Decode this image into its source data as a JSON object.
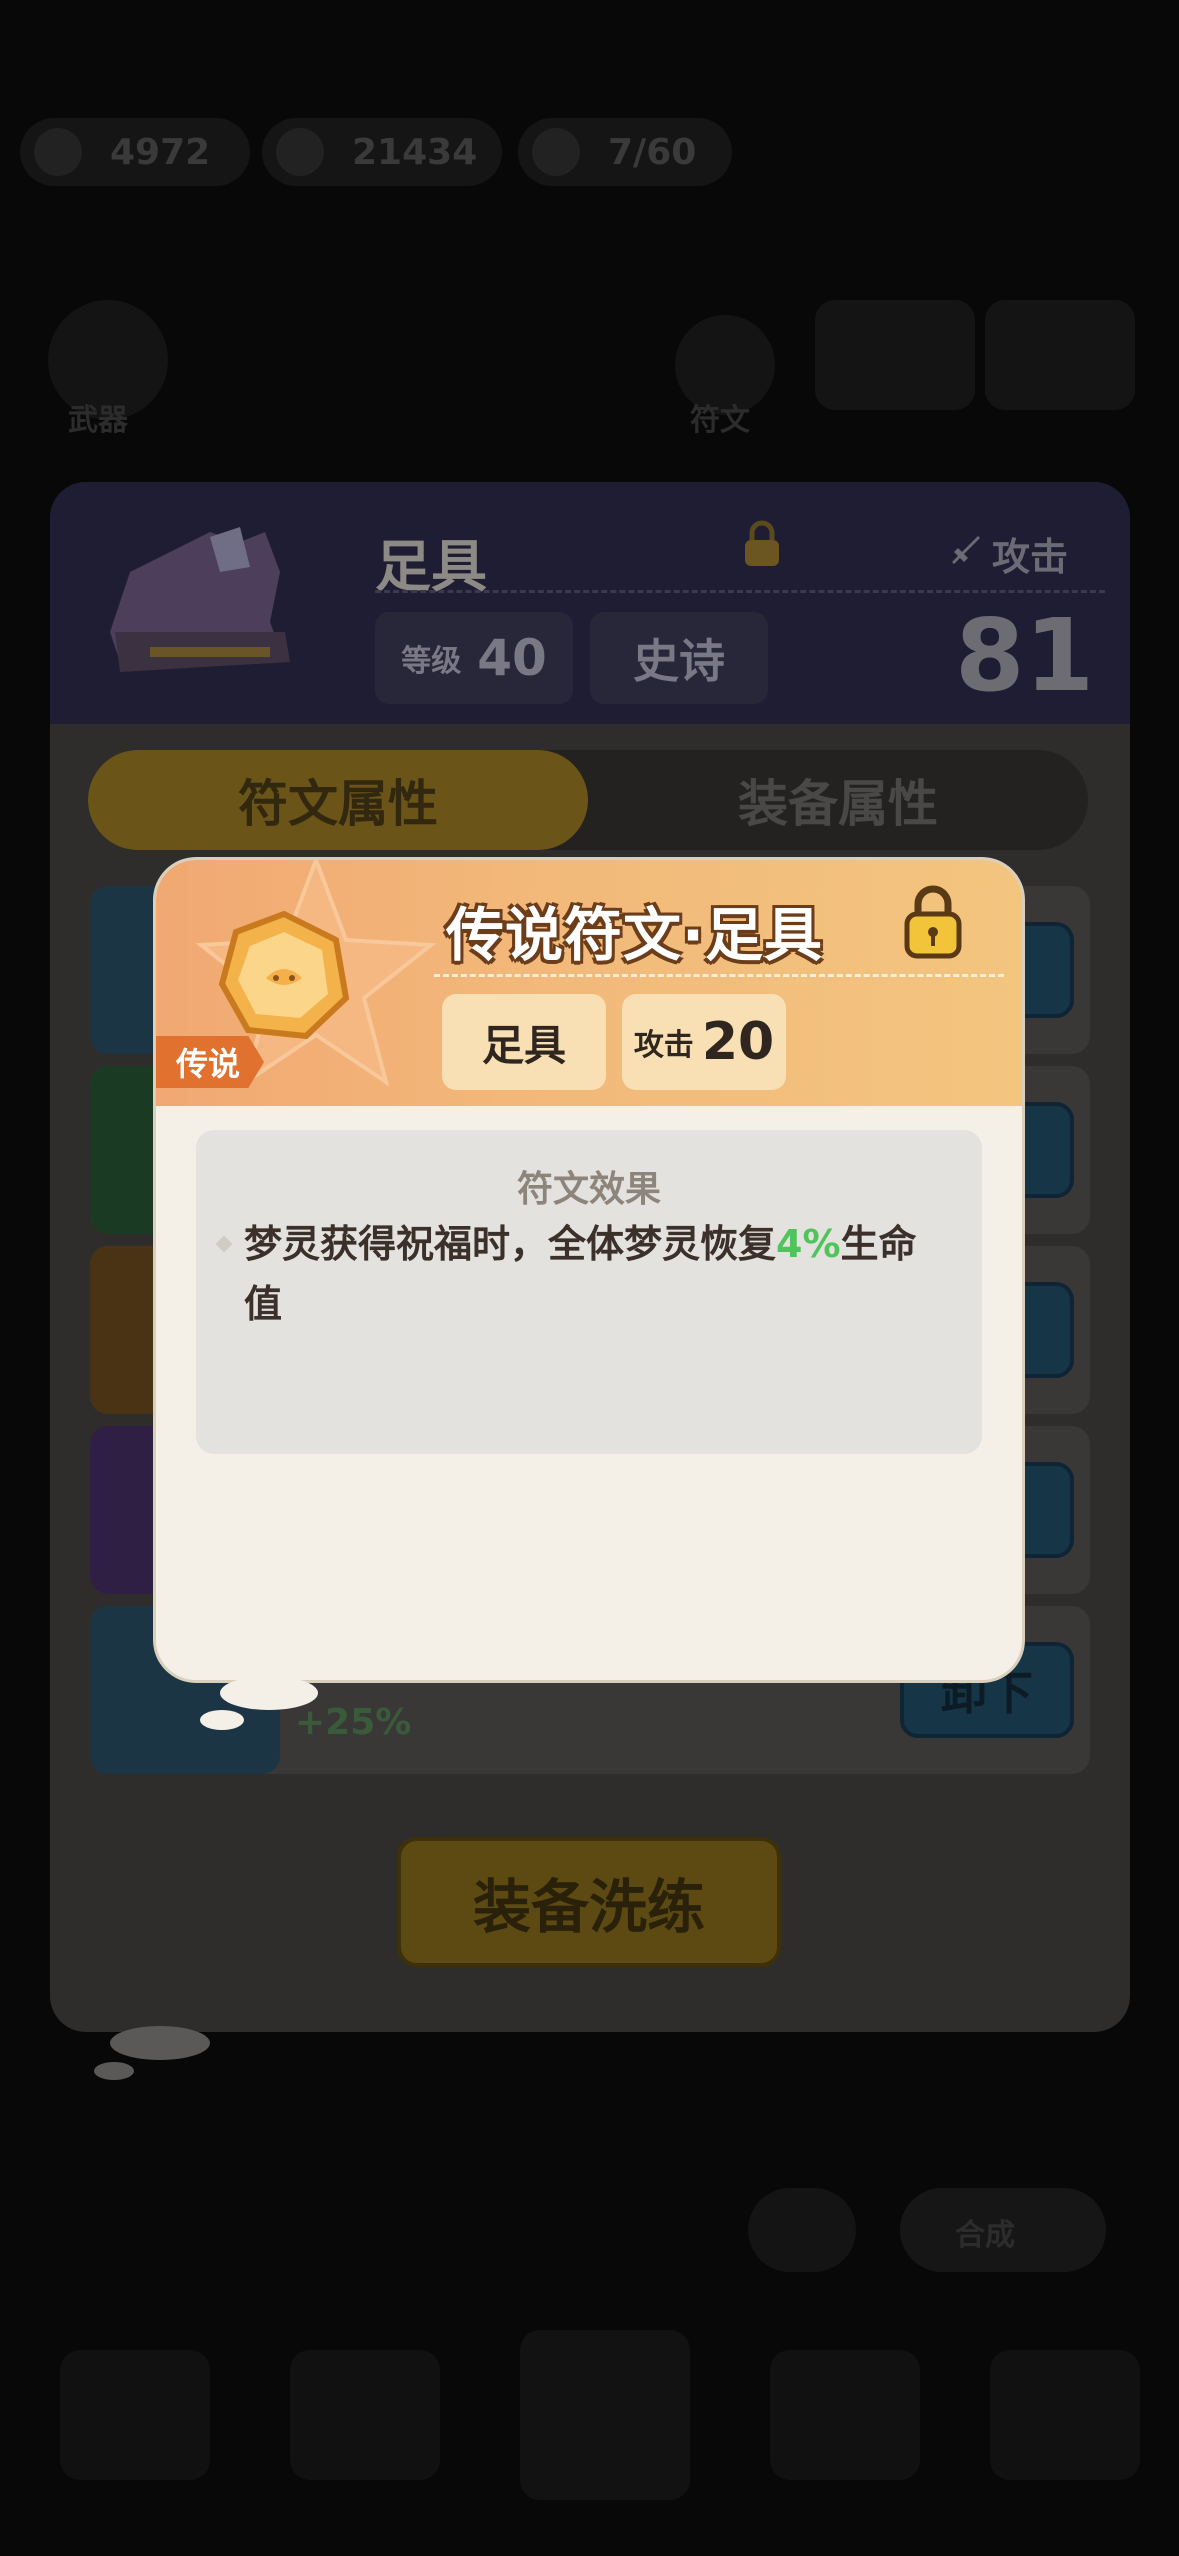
{
  "resources": [
    {
      "name": "resource-1",
      "value": "4972"
    },
    {
      "name": "resource-2",
      "value": "21434"
    },
    {
      "name": "resource-3",
      "value": "7/60"
    }
  ],
  "background": {
    "left_tab_label": "武器",
    "rune_tab_label": "符文",
    "compose_label": "合成",
    "filter_icon": "filter-icon"
  },
  "panel": {
    "item_name": "足具",
    "attack_label": "攻击",
    "attack_value": "81",
    "level_label": "等级",
    "level_value": "40",
    "rarity_label": "史诗",
    "tabs": [
      "符文属性",
      "装备属性"
    ],
    "unequip_label": "卸下",
    "bonus_text": "+25%",
    "refine_label": "装备洗练"
  },
  "popup": {
    "title": "传说符文·足具",
    "rarity_tag": "传说",
    "slot_chip": "足具",
    "attack_label": "攻击",
    "attack_value": "20",
    "effect_title": "符文效果",
    "effect_text_before": "梦灵获得祝福时，全体梦灵恢复",
    "effect_highlight": "4%",
    "effect_text_after": "生命值"
  },
  "colors": {
    "popup_header_start": "#f1a872",
    "popup_header_end": "#f3c57f",
    "highlight_green": "#4ec45a",
    "legend_tag": "#e0712f"
  }
}
